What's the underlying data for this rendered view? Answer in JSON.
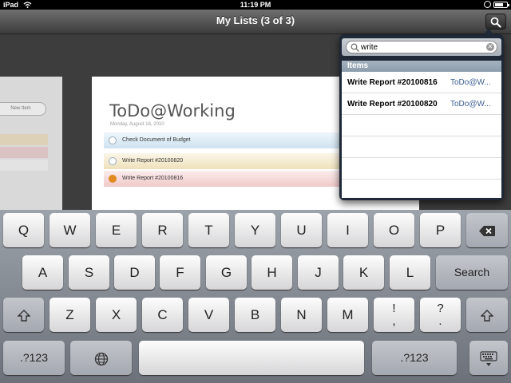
{
  "status": {
    "device": "iPad",
    "time": "11:19 PM"
  },
  "navbar": {
    "title": "My Lists (3 of 3)"
  },
  "side_card": {
    "new_item_label": "New Item"
  },
  "card": {
    "title": "ToDo@Working",
    "date": "Monday, August 16, 2010",
    "rows": [
      {
        "label": "Check Document of Budget"
      },
      {
        "label": "Write Report #20100820"
      },
      {
        "label": "Write Report #20100816"
      }
    ]
  },
  "search": {
    "value": "write",
    "section_title": "Items"
  },
  "results": [
    {
      "name": "Write Report #20100816",
      "list": "ToDo@W..."
    },
    {
      "name": "Write Report #20100820",
      "list": "ToDo@W..."
    }
  ],
  "keyboard": {
    "row1": [
      "Q",
      "W",
      "E",
      "R",
      "T",
      "Y",
      "U",
      "I",
      "O",
      "P"
    ],
    "row2": [
      "A",
      "S",
      "D",
      "F",
      "G",
      "H",
      "J",
      "K",
      "L"
    ],
    "row2_action": "Search",
    "row3": [
      "Z",
      "X",
      "C",
      "V",
      "B",
      "N",
      "M"
    ],
    "row3_punct": [
      {
        "top": "!",
        "bottom": ","
      },
      {
        "top": "?",
        "bottom": "."
      }
    ],
    "numbers_label": ".?123"
  },
  "colors": {
    "accent": "#3d5f94",
    "row_blue": "#cfe3f0",
    "row_yellow": "#efe1bb",
    "row_red": "#f0c9c9"
  },
  "icons": [
    "wifi-icon",
    "battery-icon",
    "rotation-lock-icon",
    "search-icon",
    "clear-icon",
    "shift-icon",
    "backspace-icon",
    "globe-icon",
    "keyboard-dismiss-icon"
  ]
}
